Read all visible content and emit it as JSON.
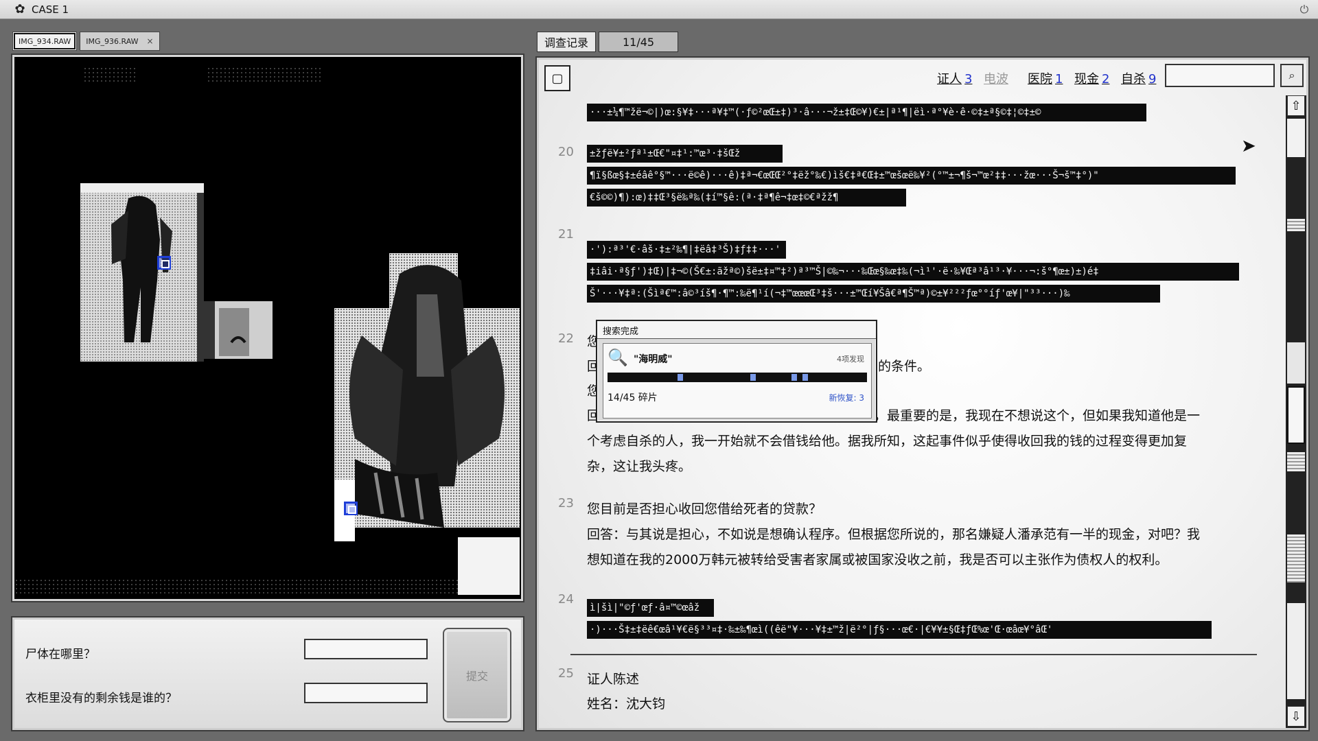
{
  "window": {
    "title": "CASE 1",
    "logo_icon": "flower-icon",
    "power_icon": "power-icon"
  },
  "left": {
    "tabs": [
      {
        "label": "IMG_934.RAW",
        "active": true
      },
      {
        "label": "IMG_936.RAW",
        "active": false,
        "close": "×"
      }
    ],
    "questions": [
      {
        "label": "尸体在哪里？",
        "value": ""
      },
      {
        "label": "衣柜里没有的剩余钱是谁的？",
        "value": ""
      }
    ],
    "submit_label": "提交"
  },
  "right": {
    "tabs": {
      "log_label": "调查记录",
      "count": "11/45"
    },
    "filters": [
      {
        "label": "证人",
        "count": "3",
        "dim": false
      },
      {
        "label": "电波",
        "count": "",
        "dim": true
      },
      {
        "label": "医院",
        "count": "1",
        "dim": false
      },
      {
        "label": "现金",
        "count": "2",
        "dim": false
      },
      {
        "label": "自杀",
        "count": "9",
        "dim": false
      }
    ],
    "search_placeholder": "",
    "entries": {
      "e19_g1": "···±¼¶™žë¬©|)œ:§¥‡···ª¥‡™(·ƒ©²œŒ±‡)³·â···¬ž±‡Œ©¥)€±|ª¹¶|ëì·ª°¥è·ê·©‡±ª§©‡¦©‡±©",
      "n20": "20",
      "e20_g1": "±žƒë¥±²ƒª¹±Œ€\"¤‡¹:™œ³·‡šŒž",
      "e20_g2": "¶ï§ßœ§‡±éâê°§™···ë©ê)···ê)‡ª¬€œŒŒ²°‡ëž°‰€)ìš€‡ª€Œ‡±™œšœë‰¥²(°™±¬¶š¬™œ²‡‡···žœ···Š¬š™‡°)\"",
      "e20_g3": "€š©©)¶):œ)‡‡Œ³§ë‰ª‰(‡í™§ê:(ª·‡ª¶ê¬‡œ‡©€ªžž¶",
      "n21": "21",
      "e21_g1": "·'):ª³'€·âš·‡±²‰¶|‡ëâ‡³Š)‡ƒ‡‡···'",
      "e21_g2": "‡iâi·ª§ƒ')‡Œ)|‡¬©(Š€±:ãžª©)šë±‡¤™‡²)ª³™Š|©‰¬···‰Œœ§‰œ‡‰(¬ì¹'·ë·‰¥Œª³â¹³·¥···¬:š°¶œ±)±)é‡",
      "e21_g3": "Š'···¥‡ª:(Šìª€™:â©³íš¶·¶™:‰ë¶¹í(¬‡™œœœŒ³‡š···±™Œí¥Šâ€ª¶Š™ª)©±¥²²²ƒœ°°íƒ'œ¥|\"³³···)‰",
      "n22": "22",
      "e22_l1": "您",
      "e22_l2_start": "回",
      "e22_l2_end": "同的条件。",
      "e22_l3": "您",
      "e22_l4": "回答：我会增加更多的利息或要求担保人。老实说，最重要的是，我现在不想说这个，但如果我知道他是一",
      "e22_l5": "个考虑自杀的人，我一开始就不会借钱给他。据我所知，这起事件似乎使得收回我的钱的过程变得更加复",
      "e22_l6": "杂，这让我头疼。",
      "n23": "23",
      "e23_l1": "您目前是否担心收回您借给死者的贷款？",
      "e23_l2": "回答：与其说是担心，不如说是想确认程序。但根据您所说的，那名嫌疑人潘承范有一半的现金，对吧？我",
      "e23_l3": "想知道在我的2000万韩元被转给受害者家属或被国家没收之前，我是否可以主张作为债权人的权利。",
      "n24": "24",
      "e24_g1": "ì|šì|\"©ƒ'œƒ·â¤™©œâž",
      "e24_g2": "·)···Š‡±‡ëê€œâ¹¥€ë§³³¤‡·‰±‰¶œì((êë\"¥···¥‡±™ž|ë²°|ƒ§···œ€·|€¥¥±§Œ‡ƒŒ%œ'Œ·œâœ¥°âŒ'",
      "n25": "25",
      "e25_l1": "证人陈述",
      "e25_l2": "姓名：沈大钧"
    }
  },
  "popup": {
    "title": "搜索完成",
    "icon": "search-stamp-icon",
    "query": "\"海明威\"",
    "found": "4项发现",
    "progress_ticks": [
      0.27,
      0.55,
      0.71,
      0.75
    ],
    "fragments": "14/45 碎片",
    "new_recovered": "新恢复: 3"
  }
}
